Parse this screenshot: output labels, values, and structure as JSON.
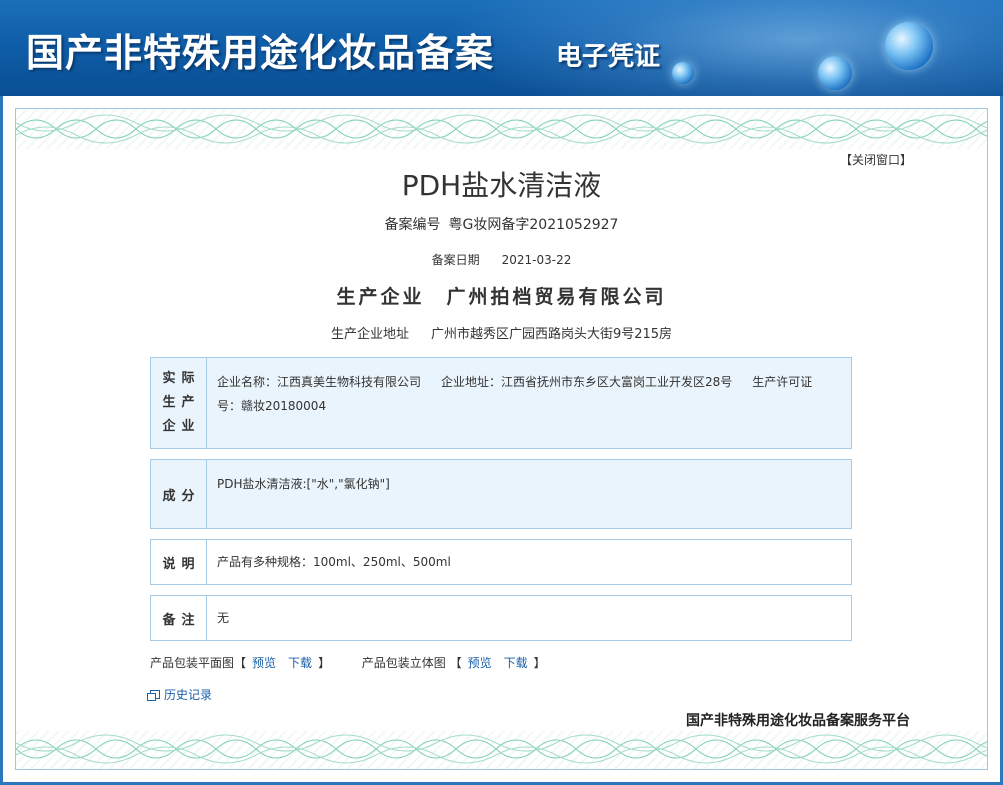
{
  "header": {
    "title": "国产非特殊用途化妆品备案",
    "subtitle": "电子凭证"
  },
  "close_link": "【关闭窗口】",
  "product": {
    "name": "PDH盐水清洁液",
    "registration_label": "备案编号",
    "registration_number": "粤G妆网备字2021052927",
    "date_label": "备案日期",
    "date_value": "2021-03-22",
    "company_label": "生产企业",
    "company_name": "广州拍档贸易有限公司",
    "address_label": "生产企业地址",
    "address_value": "广州市越秀区广园西路岗头大街9号215房"
  },
  "sections": {
    "actual_producer": {
      "heading_chars": [
        "实际",
        "生产",
        "企业"
      ],
      "line1": "企业名称：江西真美生物科技有限公司",
      "line2": "企业地址：江西省抚州市东乡区大富岗工业开发区28号",
      "line3": "生产许可证",
      "line4": "号：赣妆20180004"
    },
    "ingredients": {
      "heading": "成分",
      "text": "PDH盐水清洁液:[\"水\",\"氯化钠\"]"
    },
    "description": {
      "heading": "说明",
      "text": "产品有多种规格：100ml、250ml、500ml"
    },
    "remarks": {
      "heading": "备注",
      "text": "无"
    }
  },
  "links": {
    "flat_label": "产品包装平面图",
    "stereo_label": "产品包装立体图",
    "bracket_open": "【",
    "bracket_close": "】",
    "preview": "预览",
    "download": "下载",
    "history": "历史记录"
  },
  "footer": {
    "platform": "国产非特殊用途化妆品备案服务平台"
  },
  "colors": {
    "banner": "#0f5ea9",
    "frame_border": "#2d78bd",
    "box_blue_bg": "#eaf4fc",
    "box_border": "#a8cbe6",
    "link": "#1a5fa8"
  }
}
